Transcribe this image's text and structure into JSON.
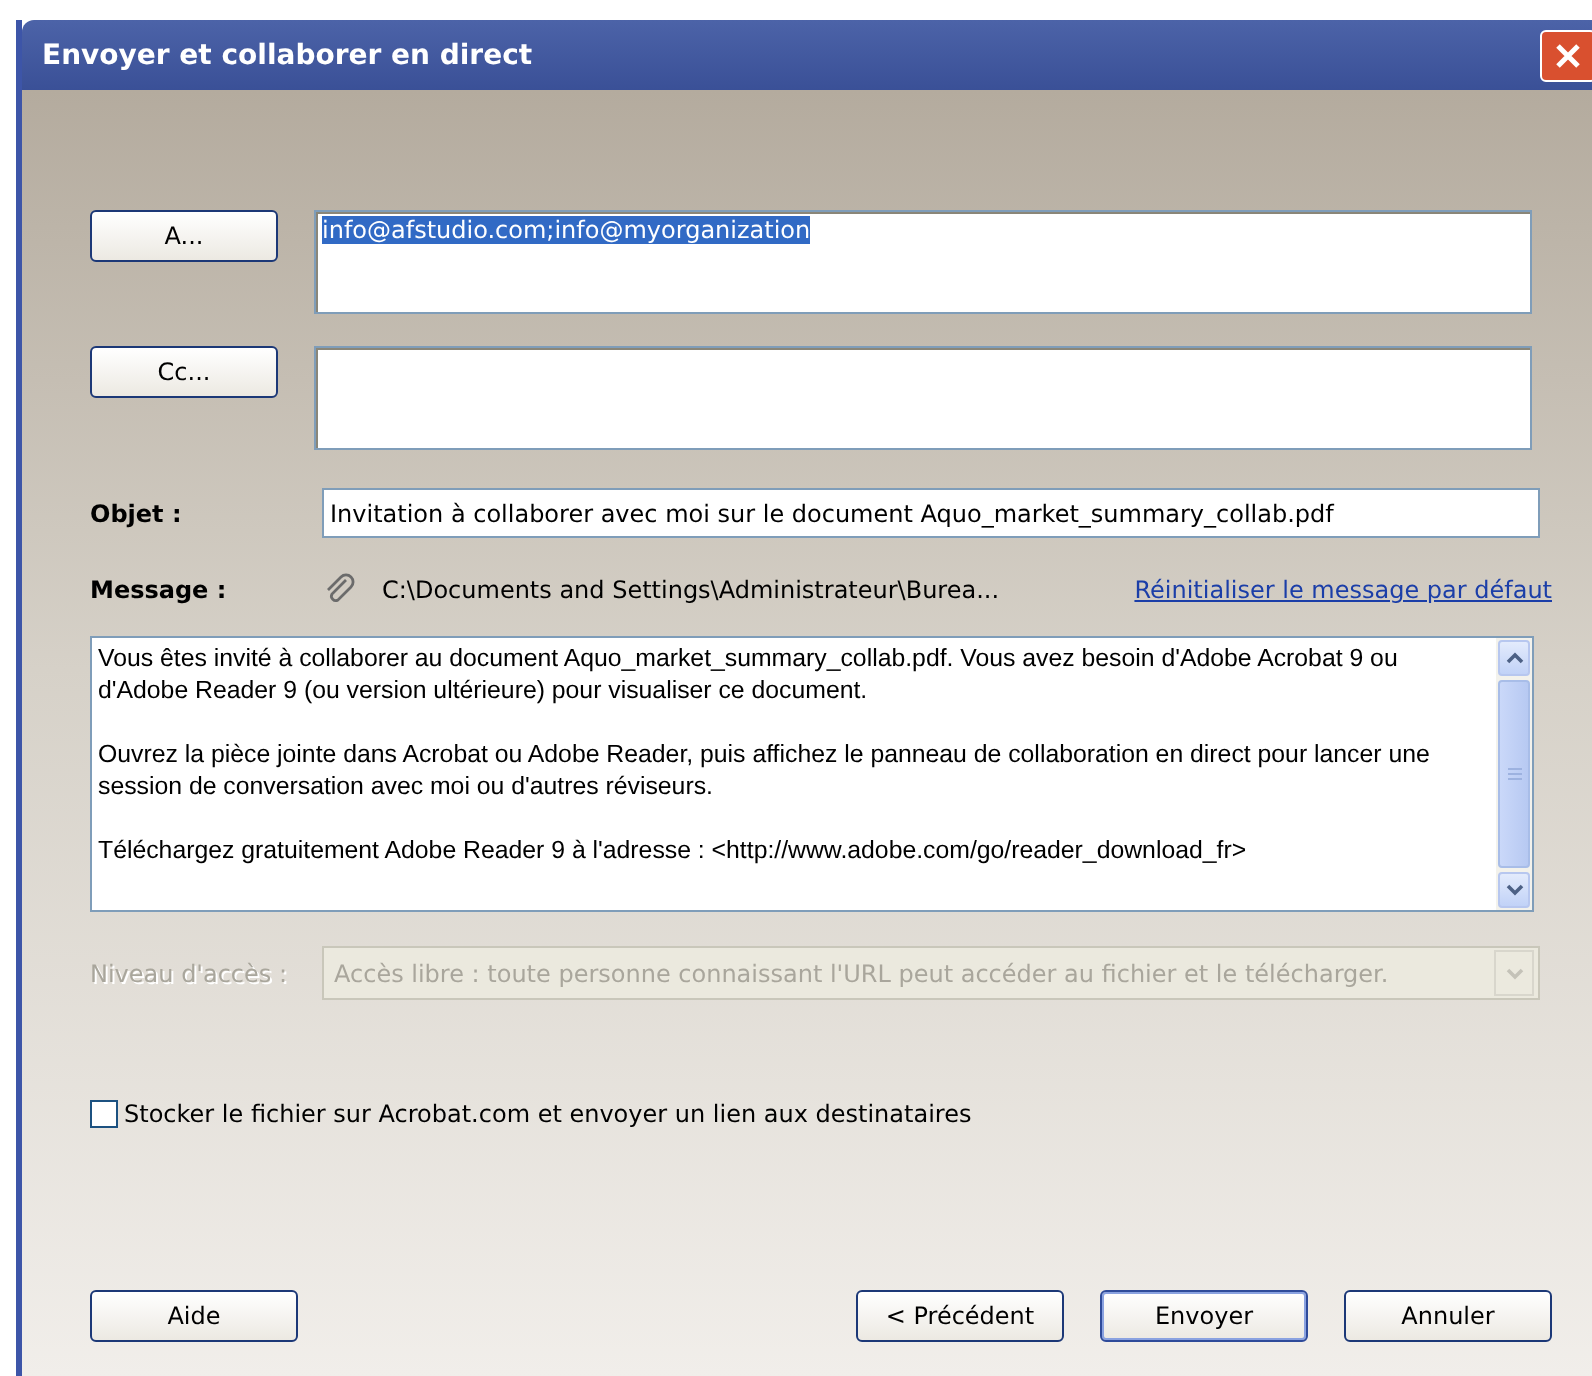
{
  "window": {
    "title": "Envoyer et collaborer en direct"
  },
  "to": {
    "button": "A...",
    "value": "info@afstudio.com;info@myorganization",
    "value_selected": true
  },
  "cc": {
    "button": "Cc..."
  },
  "subject": {
    "label": "Objet :",
    "value": "Invitation à collaborer avec moi sur le document Aquo_market_summary_collab.pdf"
  },
  "message": {
    "label": "Message :",
    "attachment": "C:\\Documents and Settings\\Administrateur\\Burea...",
    "reset_link": "Réinitialiser le message par défaut",
    "paragraphs": [
      "Vous êtes invité à collaborer au document Aquo_market_summary_collab.pdf. Vous avez besoin d'Adobe Acrobat 9 ou d'Adobe Reader 9 (ou version ultérieure) pour visualiser ce document.",
      "Ouvrez la pièce jointe dans Acrobat ou Adobe Reader, puis affichez le panneau de collaboration en direct pour lancer une session de conversation avec moi ou d'autres réviseurs.",
      "Téléchargez gratuitement Adobe Reader 9 à l'adresse : <http://www.adobe.com/go/reader_download_fr>"
    ]
  },
  "access": {
    "label": "Niveau d'accès :",
    "value": "Accès libre : toute personne connaissant l'URL peut accéder au fichier et le télécharger.",
    "disabled": true
  },
  "store_option": {
    "label": "Stocker le fichier sur Acrobat.com et envoyer un lien aux destinataires",
    "checked": false
  },
  "buttons": [
    {
      "label": "Aide",
      "default": false
    },
    {
      "label": "< Précédent",
      "default": false
    },
    {
      "label": "Envoyer",
      "default": true
    },
    {
      "label": "Annuler",
      "default": false
    }
  ]
}
